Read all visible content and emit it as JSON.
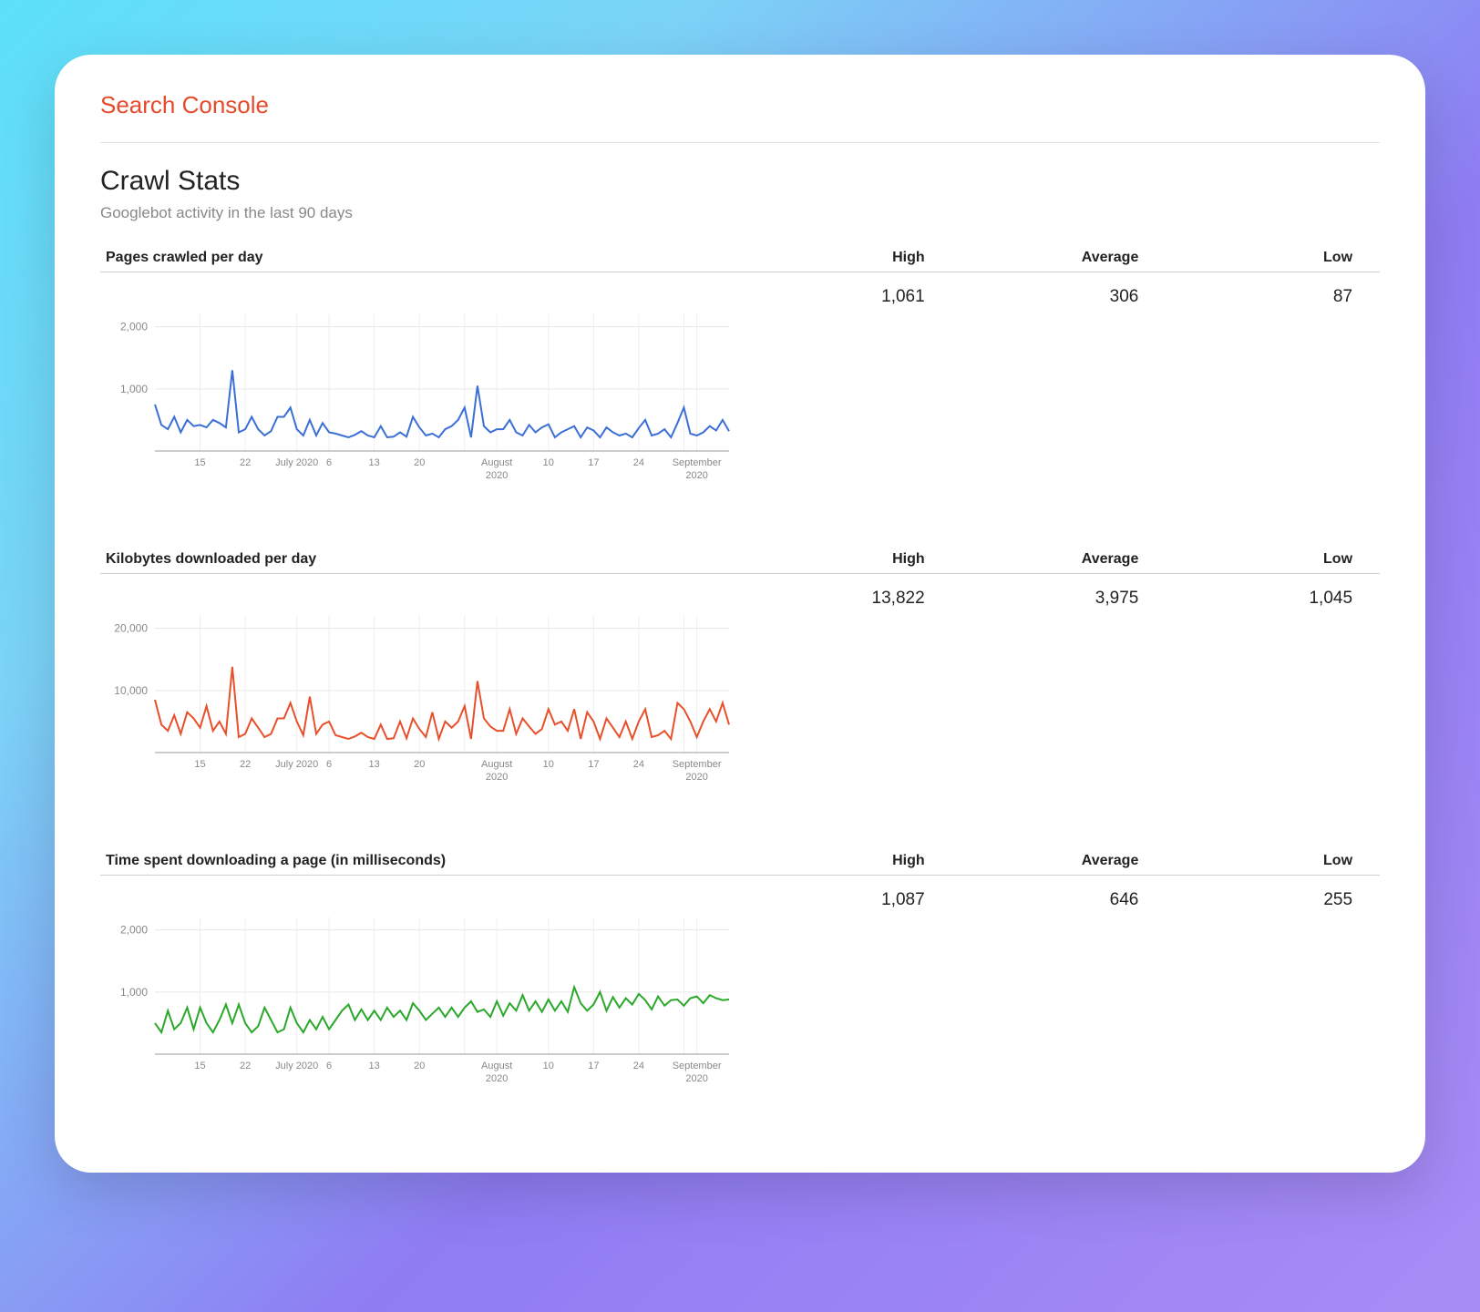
{
  "brand": "Search Console",
  "page_title": "Crawl Stats",
  "subtitle": "Googlebot activity in the last 90 days",
  "stat_headers": {
    "high": "High",
    "average": "Average",
    "low": "Low"
  },
  "sections": [
    {
      "title": "Pages crawled per day",
      "high": "1,061",
      "average": "306",
      "low": "87",
      "color": "#3b6fd6",
      "ymax": 2200,
      "yticks": [
        {
          "v": 1000,
          "label": "1,000"
        },
        {
          "v": 2000,
          "label": "2,000"
        }
      ]
    },
    {
      "title": "Kilobytes downloaded per day",
      "high": "13,822",
      "average": "3,975",
      "low": "1,045",
      "color": "#e8502c",
      "ymax": 22000,
      "yticks": [
        {
          "v": 10000,
          "label": "10,000"
        },
        {
          "v": 20000,
          "label": "20,000"
        }
      ]
    },
    {
      "title": "Time spent downloading a page (in milliseconds)",
      "high": "1,087",
      "average": "646",
      "low": "255",
      "color": "#2aa82a",
      "ymax": 2200,
      "yticks": [
        {
          "v": 1000,
          "label": "1,000"
        },
        {
          "v": 2000,
          "label": "2,000"
        }
      ]
    }
  ],
  "xticks": [
    {
      "i": 7,
      "label": "15"
    },
    {
      "i": 14,
      "label": "22"
    },
    {
      "i": 22,
      "label": "July 2020"
    },
    {
      "i": 27,
      "label": "6"
    },
    {
      "i": 34,
      "label": "13"
    },
    {
      "i": 41,
      "label": "20"
    },
    {
      "i": 53,
      "label": "August 2020"
    },
    {
      "i": 61,
      "label": "10"
    },
    {
      "i": 68,
      "label": "17"
    },
    {
      "i": 75,
      "label": "24"
    },
    {
      "i": 84,
      "label": "September 2020"
    }
  ],
  "xgrid": [
    7,
    14,
    22,
    27,
    34,
    41,
    48,
    53,
    61,
    68,
    75,
    82,
    84
  ],
  "chart_data": [
    {
      "type": "line",
      "title": "Pages crawled per day",
      "xlabel": "",
      "ylabel": "",
      "ylim": [
        0,
        2200
      ],
      "x_tick_labels": [
        "15",
        "22",
        "July 2020",
        "6",
        "13",
        "20",
        "August 2020",
        "10",
        "17",
        "24",
        "September 2020"
      ],
      "values": [
        750,
        420,
        350,
        550,
        300,
        500,
        400,
        420,
        380,
        500,
        450,
        380,
        1300,
        300,
        350,
        550,
        350,
        250,
        320,
        550,
        550,
        700,
        350,
        250,
        500,
        250,
        450,
        300,
        280,
        250,
        220,
        260,
        320,
        250,
        220,
        400,
        220,
        230,
        300,
        230,
        550,
        380,
        250,
        280,
        220,
        350,
        400,
        500,
        700,
        220,
        1050,
        400,
        300,
        350,
        350,
        500,
        300,
        250,
        420,
        300,
        380,
        430,
        220,
        300,
        350,
        400,
        220,
        380,
        330,
        220,
        380,
        300,
        250,
        280,
        220,
        370,
        500,
        250,
        280,
        350,
        220,
        450,
        700,
        280,
        250,
        300,
        400,
        330,
        500,
        320
      ]
    },
    {
      "type": "line",
      "title": "Kilobytes downloaded per day",
      "xlabel": "",
      "ylabel": "",
      "ylim": [
        0,
        22000
      ],
      "x_tick_labels": [
        "15",
        "22",
        "July 2020",
        "6",
        "13",
        "20",
        "August 2020",
        "10",
        "17",
        "24",
        "September 2020"
      ],
      "values": [
        8500,
        4500,
        3500,
        6000,
        3000,
        6500,
        5500,
        4000,
        7500,
        3500,
        5000,
        3000,
        13822,
        2500,
        3000,
        5500,
        4000,
        2500,
        3000,
        5500,
        5500,
        8000,
        5000,
        2800,
        9000,
        3000,
        4500,
        5000,
        2800,
        2500,
        2200,
        2600,
        3200,
        2500,
        2200,
        4500,
        2200,
        2300,
        5000,
        2300,
        5500,
        3800,
        2500,
        6500,
        2200,
        5000,
        4000,
        5000,
        7500,
        2200,
        11500,
        5500,
        4200,
        3500,
        3500,
        7000,
        3000,
        5500,
        4200,
        3000,
        3800,
        7000,
        4500,
        5000,
        3500,
        7000,
        2200,
        6500,
        5000,
        2200,
        5500,
        4000,
        2500,
        5000,
        2200,
        5000,
        7000,
        2500,
        2800,
        3500,
        2200,
        8000,
        7000,
        5000,
        2500,
        5000,
        7000,
        5000,
        8000,
        4500
      ]
    },
    {
      "type": "line",
      "title": "Time spent downloading a page (in milliseconds)",
      "xlabel": "",
      "ylabel": "",
      "ylim": [
        0,
        2200
      ],
      "x_tick_labels": [
        "15",
        "22",
        "July 2020",
        "6",
        "13",
        "20",
        "August 2020",
        "10",
        "17",
        "24",
        "September 2020"
      ],
      "values": [
        500,
        350,
        700,
        400,
        500,
        750,
        400,
        750,
        500,
        350,
        550,
        800,
        500,
        800,
        500,
        350,
        450,
        750,
        550,
        350,
        400,
        750,
        500,
        350,
        550,
        400,
        600,
        400,
        550,
        700,
        800,
        550,
        720,
        550,
        700,
        550,
        750,
        600,
        700,
        550,
        820,
        700,
        550,
        650,
        750,
        600,
        750,
        600,
        750,
        850,
        680,
        720,
        600,
        850,
        620,
        820,
        700,
        950,
        700,
        850,
        680,
        880,
        700,
        850,
        680,
        1080,
        820,
        700,
        800,
        1000,
        700,
        920,
        750,
        900,
        800,
        970,
        870,
        720,
        930,
        780,
        870,
        880,
        780,
        900,
        930,
        820,
        950,
        900,
        870,
        880
      ]
    }
  ]
}
